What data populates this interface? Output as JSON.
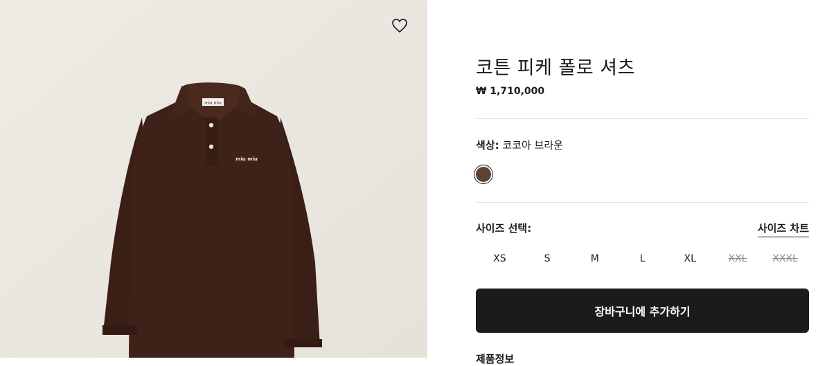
{
  "product": {
    "name": "코튼 피케 폴로 셔츠",
    "price": "₩ 1,710,000",
    "image_logo_text": "miu miu",
    "garment_color": "#3e2219"
  },
  "color": {
    "label": "색상:",
    "value": "코코아 브라운",
    "swatch_hex": "#5d4336"
  },
  "size": {
    "label": "사이즈 선택:",
    "chart_link": "사이즈 차트",
    "options": [
      {
        "label": "XS",
        "available": true
      },
      {
        "label": "S",
        "available": true
      },
      {
        "label": "M",
        "available": true
      },
      {
        "label": "L",
        "available": true
      },
      {
        "label": "XL",
        "available": true
      },
      {
        "label": "XXL",
        "available": false
      },
      {
        "label": "XXXL",
        "available": false
      }
    ]
  },
  "cart_button": "장바구니에 추가하기",
  "cut_off_text": "제품정보"
}
